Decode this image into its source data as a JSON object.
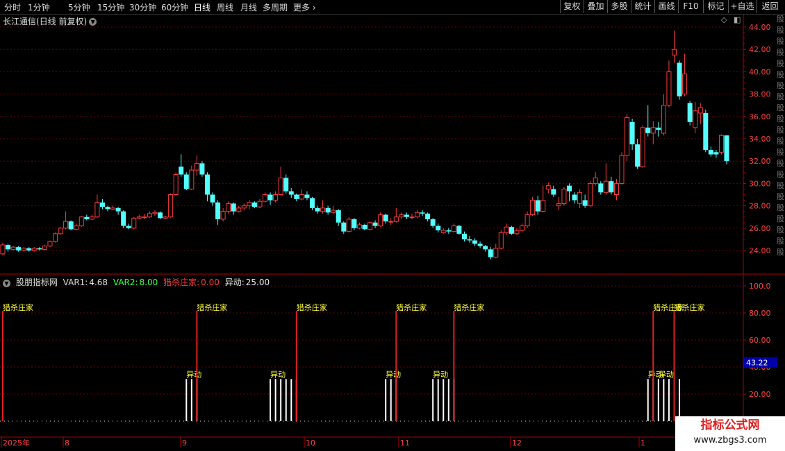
{
  "toolbar": {
    "periods": [
      "分时",
      "1分钟",
      "5分钟",
      "15分钟",
      "30分钟",
      "60分钟",
      "日线",
      "周线",
      "月线",
      "多周期",
      "更多"
    ],
    "active_period": "日线",
    "right_buttons": [
      "复权",
      "叠加",
      "多股",
      "统计",
      "画线",
      "F10",
      "标记",
      "+自选",
      "返回"
    ]
  },
  "title": {
    "stock": "长江通信",
    "mode": "(日线 前复权)"
  },
  "indicator": {
    "name": "股朋指标网",
    "var1_label": "VAR1:",
    "var1_value": "4.68",
    "var2_label": "VAR2:",
    "var2_value": "8.00",
    "lieshazhuangjia_label": "猎杀庄家:",
    "lieshazhuangjia_value": "0.00",
    "yidong_label": "异动:",
    "yidong_value": "25.00",
    "marker_text": "猎杀庄家",
    "yidong_text": "异动",
    "current_value": "43.22"
  },
  "axis": {
    "price_ticks": [
      "44.00",
      "42.00",
      "40.00",
      "38.00",
      "36.00",
      "34.00",
      "32.00",
      "30.00",
      "28.00",
      "26.00",
      "24.00"
    ],
    "indicator_ticks": [
      "100.0",
      "80.00",
      "60.00",
      "40.00",
      "20.00"
    ],
    "date_labels": [
      "2025年",
      "8",
      "9",
      "10",
      "11",
      "12",
      "1"
    ]
  },
  "right_strip_text": "股股股股股股股股股股股股股股股股股股股股股股",
  "watermark": {
    "line1": "指标公式网",
    "line2": "www.zbgs3.com"
  },
  "colors": {
    "up": "#ff3b3b",
    "down": "#54ffff",
    "yellow": "#ffff40",
    "grid": "#6b0000",
    "axis": "#b00000"
  },
  "chart_data": {
    "type": "candlestick",
    "price_range": [
      23,
      44.5
    ],
    "candles": [
      {
        "o": 23.7,
        "c": 24.5,
        "h": 24.7,
        "l": 23.6
      },
      {
        "o": 24.5,
        "c": 24.1,
        "h": 24.6,
        "l": 23.9
      },
      {
        "o": 24.1,
        "c": 24.3,
        "h": 24.4,
        "l": 24.0
      },
      {
        "o": 24.3,
        "c": 24.0,
        "h": 24.4,
        "l": 23.9
      },
      {
        "o": 24.0,
        "c": 24.2,
        "h": 24.3,
        "l": 23.9
      },
      {
        "o": 24.2,
        "c": 24.0,
        "h": 24.3,
        "l": 23.9
      },
      {
        "o": 24.0,
        "c": 24.2,
        "h": 24.3,
        "l": 23.9
      },
      {
        "o": 24.2,
        "c": 24.1,
        "h": 24.3,
        "l": 24.0
      },
      {
        "o": 24.1,
        "c": 24.4,
        "h": 24.5,
        "l": 24.0
      },
      {
        "o": 24.4,
        "c": 24.8,
        "h": 24.9,
        "l": 24.3
      },
      {
        "o": 24.8,
        "c": 25.5,
        "h": 25.6,
        "l": 24.7
      },
      {
        "o": 25.5,
        "c": 26.0,
        "h": 26.1,
        "l": 25.4
      },
      {
        "o": 26.0,
        "c": 26.6,
        "h": 27.5,
        "l": 25.9
      },
      {
        "o": 26.6,
        "c": 25.9,
        "h": 26.7,
        "l": 25.8
      },
      {
        "o": 25.9,
        "c": 26.2,
        "h": 26.4,
        "l": 25.8
      },
      {
        "o": 26.2,
        "c": 27.0,
        "h": 27.1,
        "l": 26.1
      },
      {
        "o": 27.0,
        "c": 26.8,
        "h": 27.2,
        "l": 26.7
      },
      {
        "o": 26.8,
        "c": 27.0,
        "h": 27.2,
        "l": 26.7
      },
      {
        "o": 27.0,
        "c": 28.3,
        "h": 29.0,
        "l": 26.9
      },
      {
        "o": 28.3,
        "c": 27.9,
        "h": 28.6,
        "l": 27.7
      },
      {
        "o": 27.9,
        "c": 27.7,
        "h": 28.0,
        "l": 27.5
      },
      {
        "o": 27.7,
        "c": 27.8,
        "h": 28.0,
        "l": 27.6
      },
      {
        "o": 27.8,
        "c": 27.5,
        "h": 27.9,
        "l": 27.2
      },
      {
        "o": 27.5,
        "c": 26.2,
        "h": 27.6,
        "l": 26.0
      },
      {
        "o": 26.2,
        "c": 26.0,
        "h": 26.4,
        "l": 25.9
      },
      {
        "o": 26.0,
        "c": 26.9,
        "h": 27.0,
        "l": 25.9
      },
      {
        "o": 26.9,
        "c": 27.0,
        "h": 27.2,
        "l": 26.8
      },
      {
        "o": 27.0,
        "c": 27.0,
        "h": 27.3,
        "l": 26.8
      },
      {
        "o": 27.0,
        "c": 27.3,
        "h": 27.5,
        "l": 26.9
      },
      {
        "o": 27.3,
        "c": 27.4,
        "h": 27.6,
        "l": 27.1
      },
      {
        "o": 27.4,
        "c": 26.9,
        "h": 27.5,
        "l": 26.8
      },
      {
        "o": 26.9,
        "c": 27.0,
        "h": 27.1,
        "l": 26.8
      },
      {
        "o": 27.0,
        "c": 29.0,
        "h": 29.1,
        "l": 26.9
      },
      {
        "o": 29.0,
        "c": 30.8,
        "h": 31.0,
        "l": 28.9
      },
      {
        "o": 31.5,
        "c": 30.8,
        "h": 32.6,
        "l": 30.6
      },
      {
        "o": 30.8,
        "c": 29.5,
        "h": 31.0,
        "l": 29.4
      },
      {
        "o": 29.5,
        "c": 31.2,
        "h": 31.6,
        "l": 29.4
      },
      {
        "o": 31.2,
        "c": 31.8,
        "h": 32.5,
        "l": 30.7
      },
      {
        "o": 31.8,
        "c": 30.8,
        "h": 32.0,
        "l": 30.6
      },
      {
        "o": 30.8,
        "c": 29.0,
        "h": 31.0,
        "l": 28.4
      },
      {
        "o": 29.0,
        "c": 28.3,
        "h": 29.2,
        "l": 28.0
      },
      {
        "o": 28.3,
        "c": 26.8,
        "h": 28.5,
        "l": 26.3
      },
      {
        "o": 26.8,
        "c": 27.5,
        "h": 27.8,
        "l": 26.6
      },
      {
        "o": 27.5,
        "c": 28.2,
        "h": 28.4,
        "l": 27.3
      },
      {
        "o": 28.2,
        "c": 27.5,
        "h": 28.3,
        "l": 27.2
      },
      {
        "o": 27.5,
        "c": 27.8,
        "h": 28.0,
        "l": 27.4
      },
      {
        "o": 27.8,
        "c": 28.0,
        "h": 28.2,
        "l": 27.6
      },
      {
        "o": 28.0,
        "c": 28.3,
        "h": 28.5,
        "l": 27.7
      },
      {
        "o": 28.3,
        "c": 27.9,
        "h": 28.4,
        "l": 27.8
      },
      {
        "o": 27.9,
        "c": 28.4,
        "h": 28.6,
        "l": 27.8
      },
      {
        "o": 28.4,
        "c": 29.0,
        "h": 29.2,
        "l": 28.3
      },
      {
        "o": 29.0,
        "c": 28.5,
        "h": 29.2,
        "l": 28.1
      },
      {
        "o": 28.5,
        "c": 29.0,
        "h": 29.3,
        "l": 28.3
      },
      {
        "o": 29.0,
        "c": 30.5,
        "h": 31.5,
        "l": 28.9
      },
      {
        "o": 30.5,
        "c": 29.3,
        "h": 30.8,
        "l": 29.1
      },
      {
        "o": 29.3,
        "c": 29.0,
        "h": 29.6,
        "l": 28.7
      },
      {
        "o": 29.0,
        "c": 28.6,
        "h": 29.1,
        "l": 28.4
      },
      {
        "o": 28.6,
        "c": 29.0,
        "h": 29.5,
        "l": 28.5
      },
      {
        "o": 29.0,
        "c": 28.7,
        "h": 29.3,
        "l": 28.5
      },
      {
        "o": 28.7,
        "c": 27.8,
        "h": 28.8,
        "l": 27.6
      },
      {
        "o": 27.8,
        "c": 27.5,
        "h": 28.0,
        "l": 27.3
      },
      {
        "o": 27.5,
        "c": 27.8,
        "h": 28.5,
        "l": 27.3
      },
      {
        "o": 27.8,
        "c": 27.4,
        "h": 28.0,
        "l": 27.2
      },
      {
        "o": 27.4,
        "c": 27.6,
        "h": 28.0,
        "l": 27.3
      },
      {
        "o": 27.6,
        "c": 26.5,
        "h": 27.7,
        "l": 26.2
      },
      {
        "o": 26.5,
        "c": 25.7,
        "h": 26.6,
        "l": 25.5
      },
      {
        "o": 25.7,
        "c": 26.8,
        "h": 27.0,
        "l": 25.6
      },
      {
        "o": 26.8,
        "c": 26.0,
        "h": 26.9,
        "l": 25.8
      },
      {
        "o": 26.0,
        "c": 26.3,
        "h": 26.5,
        "l": 25.9
      },
      {
        "o": 26.3,
        "c": 25.9,
        "h": 26.4,
        "l": 25.8
      },
      {
        "o": 25.9,
        "c": 26.5,
        "h": 26.6,
        "l": 25.8
      },
      {
        "o": 26.5,
        "c": 26.2,
        "h": 26.7,
        "l": 26.0
      },
      {
        "o": 26.2,
        "c": 27.2,
        "h": 27.4,
        "l": 26.1
      },
      {
        "o": 27.2,
        "c": 26.6,
        "h": 27.3,
        "l": 26.4
      },
      {
        "o": 26.6,
        "c": 26.6,
        "h": 26.9,
        "l": 26.3
      },
      {
        "o": 26.6,
        "c": 27.0,
        "h": 27.8,
        "l": 26.5
      },
      {
        "o": 27.0,
        "c": 27.2,
        "h": 27.4,
        "l": 26.8
      },
      {
        "o": 27.2,
        "c": 27.0,
        "h": 27.4,
        "l": 26.8
      },
      {
        "o": 27.0,
        "c": 27.0,
        "h": 27.3,
        "l": 26.8
      },
      {
        "o": 27.0,
        "c": 27.4,
        "h": 27.6,
        "l": 26.9
      },
      {
        "o": 27.4,
        "c": 27.3,
        "h": 27.6,
        "l": 27.1
      },
      {
        "o": 27.3,
        "c": 26.8,
        "h": 27.4,
        "l": 26.6
      },
      {
        "o": 26.8,
        "c": 26.2,
        "h": 26.9,
        "l": 26.0
      },
      {
        "o": 26.2,
        "c": 25.8,
        "h": 26.4,
        "l": 25.6
      },
      {
        "o": 25.6,
        "c": 25.8,
        "h": 26.0,
        "l": 25.5
      },
      {
        "o": 25.8,
        "c": 25.7,
        "h": 26.0,
        "l": 25.5
      },
      {
        "o": 25.7,
        "c": 26.2,
        "h": 26.4,
        "l": 25.6
      },
      {
        "o": 26.2,
        "c": 25.5,
        "h": 26.3,
        "l": 25.4
      },
      {
        "o": 25.5,
        "c": 25.0,
        "h": 25.7,
        "l": 24.8
      },
      {
        "o": 25.0,
        "c": 24.9,
        "h": 25.3,
        "l": 24.7
      },
      {
        "o": 24.9,
        "c": 24.6,
        "h": 25.1,
        "l": 24.4
      },
      {
        "o": 24.6,
        "c": 24.4,
        "h": 24.8,
        "l": 24.2
      },
      {
        "o": 24.4,
        "c": 24.1,
        "h": 24.5,
        "l": 23.9
      },
      {
        "o": 24.1,
        "c": 23.4,
        "h": 24.3,
        "l": 23.2
      },
      {
        "o": 23.4,
        "c": 24.2,
        "h": 24.6,
        "l": 23.3
      },
      {
        "o": 24.2,
        "c": 25.6,
        "h": 25.8,
        "l": 24.1
      },
      {
        "o": 25.6,
        "c": 26.1,
        "h": 26.4,
        "l": 25.4
      },
      {
        "o": 26.1,
        "c": 25.5,
        "h": 26.2,
        "l": 25.4
      },
      {
        "o": 25.5,
        "c": 25.8,
        "h": 26.0,
        "l": 25.4
      },
      {
        "o": 25.8,
        "c": 26.2,
        "h": 26.4,
        "l": 25.6
      },
      {
        "o": 26.2,
        "c": 27.2,
        "h": 27.5,
        "l": 26.0
      },
      {
        "o": 27.2,
        "c": 28.5,
        "h": 28.8,
        "l": 27.1
      },
      {
        "o": 28.5,
        "c": 27.5,
        "h": 28.9,
        "l": 27.2
      },
      {
        "o": 27.5,
        "c": 28.5,
        "h": 29.8,
        "l": 27.4
      },
      {
        "o": 29.5,
        "c": 29.8,
        "h": 30.1,
        "l": 29.1
      },
      {
        "o": 29.5,
        "c": 29.0,
        "h": 29.8,
        "l": 28.8
      },
      {
        "o": 28.0,
        "c": 28.2,
        "h": 28.8,
        "l": 27.6
      },
      {
        "o": 28.2,
        "c": 29.5,
        "h": 29.7,
        "l": 28.0
      },
      {
        "o": 29.8,
        "c": 29.3,
        "h": 30.0,
        "l": 28.4
      },
      {
        "o": 29.0,
        "c": 28.5,
        "h": 29.2,
        "l": 28.2
      },
      {
        "o": 28.2,
        "c": 29.2,
        "h": 29.5,
        "l": 27.8
      },
      {
        "o": 28.5,
        "c": 28.0,
        "h": 29.0,
        "l": 27.8
      },
      {
        "o": 28.0,
        "c": 30.0,
        "h": 30.2,
        "l": 27.9
      },
      {
        "o": 30.0,
        "c": 30.5,
        "h": 31.0,
        "l": 29.8
      },
      {
        "o": 30.0,
        "c": 29.2,
        "h": 30.2,
        "l": 29.0
      },
      {
        "o": 29.2,
        "c": 30.2,
        "h": 31.8,
        "l": 29.0
      },
      {
        "o": 30.2,
        "c": 29.2,
        "h": 30.6,
        "l": 29.0
      },
      {
        "o": 29.0,
        "c": 30.0,
        "h": 30.4,
        "l": 28.5
      },
      {
        "o": 30.0,
        "c": 32.5,
        "h": 32.8,
        "l": 29.9
      },
      {
        "o": 32.5,
        "c": 35.9,
        "h": 36.2,
        "l": 32.0
      },
      {
        "o": 35.5,
        "c": 33.5,
        "h": 35.8,
        "l": 33.0
      },
      {
        "o": 33.5,
        "c": 31.5,
        "h": 34.0,
        "l": 31.3
      },
      {
        "o": 31.5,
        "c": 35.0,
        "h": 35.2,
        "l": 31.4
      },
      {
        "o": 35.0,
        "c": 34.5,
        "h": 37.0,
        "l": 34.2
      },
      {
        "o": 34.5,
        "c": 35.0,
        "h": 35.6,
        "l": 33.5
      },
      {
        "o": 35.0,
        "c": 34.8,
        "h": 35.5,
        "l": 34.2
      },
      {
        "o": 34.5,
        "c": 37.0,
        "h": 38.0,
        "l": 34.3
      },
      {
        "o": 37.0,
        "c": 40.0,
        "h": 41.0,
        "l": 36.8
      },
      {
        "o": 41.5,
        "c": 42.0,
        "h": 43.7,
        "l": 40.8
      },
      {
        "o": 40.8,
        "c": 37.8,
        "h": 41.0,
        "l": 37.5
      },
      {
        "o": 38.0,
        "c": 39.8,
        "h": 41.6,
        "l": 37.8
      },
      {
        "o": 37.2,
        "c": 35.5,
        "h": 37.4,
        "l": 35.2
      },
      {
        "o": 35.0,
        "c": 36.5,
        "h": 37.3,
        "l": 34.5
      },
      {
        "o": 36.3,
        "c": 36.8,
        "h": 37.2,
        "l": 35.3
      },
      {
        "o": 36.3,
        "c": 33.0,
        "h": 36.6,
        "l": 32.8
      },
      {
        "o": 33.0,
        "c": 32.6,
        "h": 33.3,
        "l": 32.4
      },
      {
        "o": 32.8,
        "c": 32.6,
        "h": 33.0,
        "l": 32.3
      },
      {
        "o": 32.8,
        "c": 34.3,
        "h": 34.4,
        "l": 32.6
      },
      {
        "o": 34.3,
        "c": 32.0,
        "h": 34.3,
        "l": 31.7
      }
    ],
    "lieshazhuangjia_signal_days": [
      0,
      37,
      56,
      75,
      86,
      124,
      128
    ],
    "yidong_signal_days": [
      35,
      36,
      37,
      51,
      52,
      53,
      54,
      55,
      56,
      73,
      74,
      75,
      82,
      83,
      84,
      85,
      86,
      123,
      124,
      125,
      126,
      127,
      128,
      129
    ],
    "yidong_text_anchor_days": [
      35,
      51,
      73,
      82,
      123,
      125
    ],
    "signal_levels": {
      "lieshazhuangjia": 80,
      "yidong": 25
    },
    "indicator_range": [
      0,
      100
    ]
  }
}
